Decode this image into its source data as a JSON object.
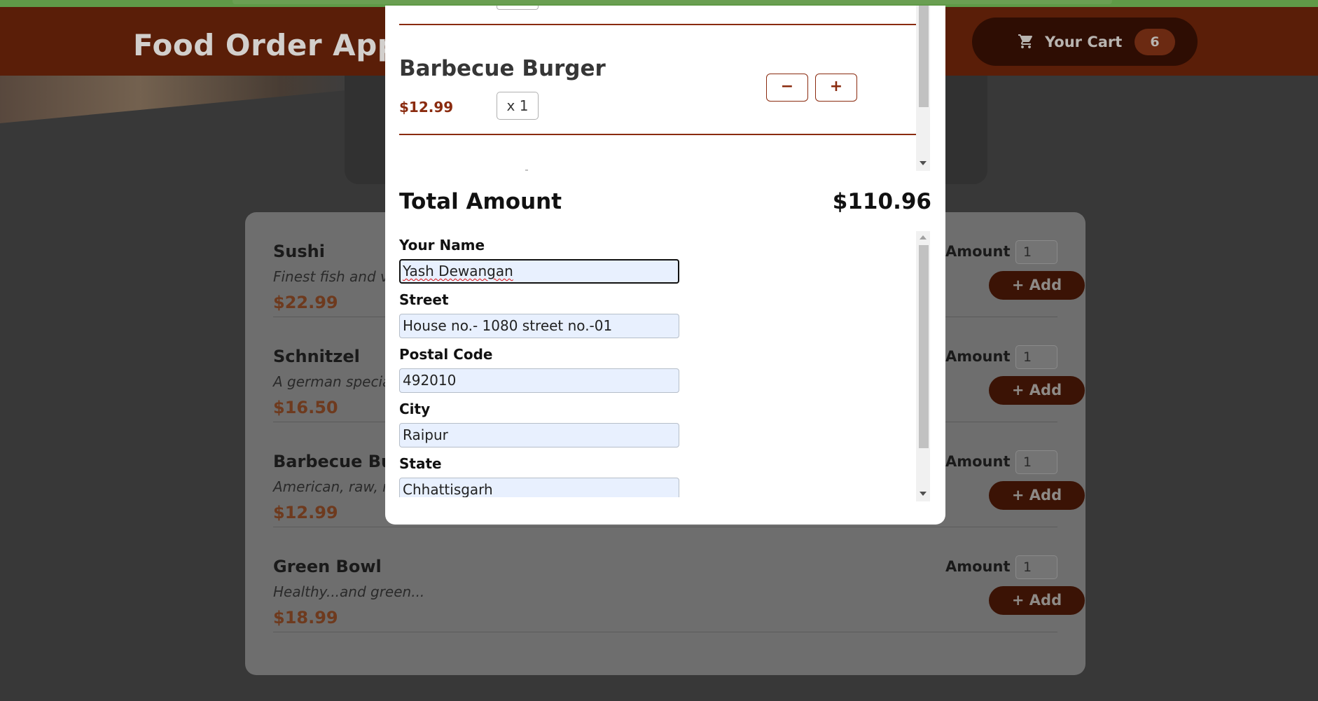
{
  "header": {
    "app_title": "Food Order App",
    "cart_label": "Your Cart",
    "cart_count": "6"
  },
  "meals": [
    {
      "name": "Sushi",
      "description": "Finest fish and ve",
      "price": "$22.99",
      "amount_label": "Amount",
      "amount_value": "1",
      "add_label": "+ Add"
    },
    {
      "name": "Schnitzel",
      "description": "A german special",
      "price": "$16.50",
      "amount_label": "Amount",
      "amount_value": "1",
      "add_label": "+ Add"
    },
    {
      "name": "Barbecue Burg",
      "description": "American, raw, m",
      "price": "$12.99",
      "amount_label": "Amount",
      "amount_value": "1",
      "add_label": "+ Add"
    },
    {
      "name": "Green Bowl",
      "description": "Healthy...and green...",
      "price": "$18.99",
      "amount_label": "Amount",
      "amount_value": "1",
      "add_label": "+ Add"
    }
  ],
  "cart_modal": {
    "item": {
      "name": "Barbecue Burger",
      "price": "$12.99",
      "quantity": "x 1",
      "minus_label": "−",
      "plus_label": "+"
    },
    "total_label": "Total Amount",
    "total_value": "$110.96",
    "form": {
      "name_label": "Your Name",
      "name_value": "Yash Dewangan",
      "street_label": "Street",
      "street_value": "House no.- 1080 street no.-01",
      "postal_label": "Postal Code",
      "postal_value": "492010",
      "city_label": "City",
      "city_value": "Raipur",
      "state_label": "State",
      "state_value": "Chhattisgarh"
    }
  },
  "colors": {
    "header_bg": "#5a1e08",
    "accent": "#8a2b0f",
    "overlay_bg": "#383838",
    "autofill_bg": "#e8f0fe"
  },
  "icons": {
    "cart": "cart-icon"
  }
}
